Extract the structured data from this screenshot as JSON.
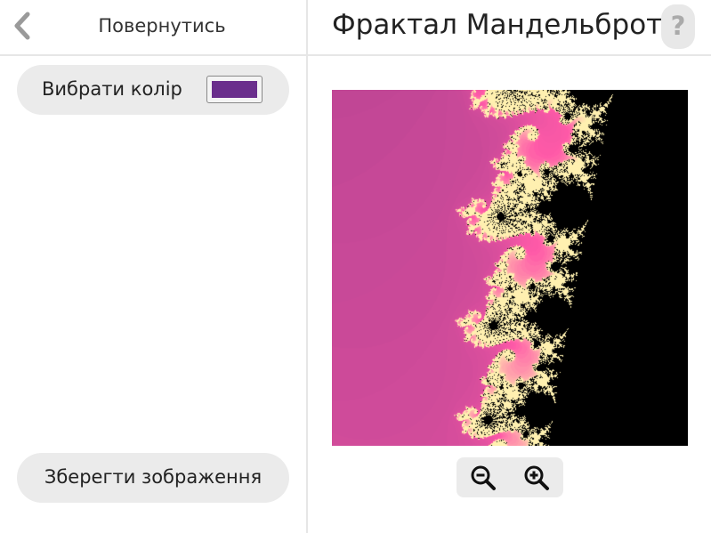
{
  "header": {
    "back_label": "Повернутись",
    "title": "Фрактал Мандельброта",
    "help_symbol": "?"
  },
  "controls": {
    "pick_color_label": "Вибрати колір",
    "selected_color": "#6a2e8c",
    "save_label": "Зберегти зображення"
  },
  "icons": {
    "back": "chevron-left-icon",
    "help": "question-mark-icon",
    "zoom_out": "zoom-out-icon",
    "zoom_in": "zoom-in-icon"
  },
  "colors": {
    "fractal_background": "#833383",
    "fractal_interior": "#000000",
    "fractal_edge": "#ff5aa8",
    "fractal_highlight": "#fff0b0",
    "panel_gray": "#ebebeb"
  }
}
